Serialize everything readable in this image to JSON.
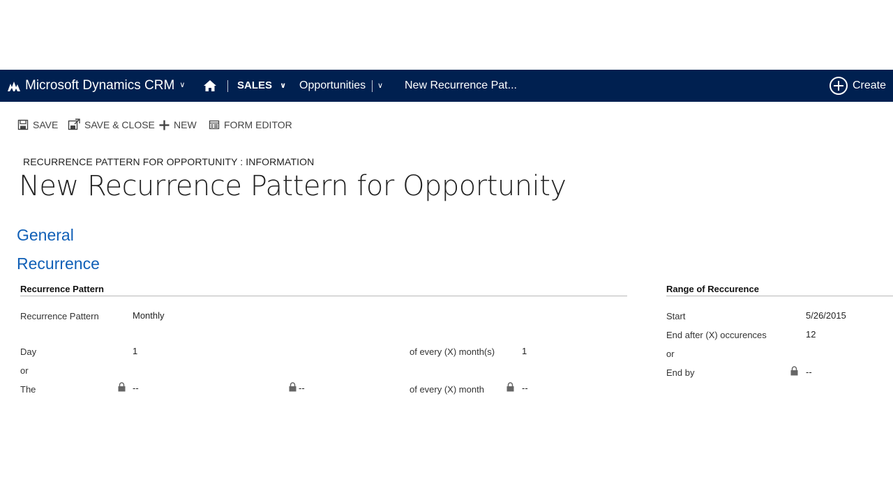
{
  "navbar": {
    "brand": "Microsoft Dynamics CRM",
    "area": "SALES",
    "entity": "Opportunities",
    "record": "New Recurrence Pat...",
    "create": "Create"
  },
  "commands": {
    "save": "SAVE",
    "save_close": "SAVE & CLOSE",
    "new": "NEW",
    "form_editor": "FORM EDITOR"
  },
  "header": {
    "entity_label": "RECURRENCE PATTERN FOR OPPORTUNITY : INFORMATION",
    "title": "New Recurrence Pattern for Opportunity"
  },
  "tabs": {
    "general": "General",
    "recurrence": "Recurrence"
  },
  "recurrence_pattern": {
    "section_title": "Recurrence Pattern",
    "pattern_label": "Recurrence Pattern",
    "pattern_value": "Monthly",
    "day_label": "Day",
    "day_value": "1",
    "or_label": "or",
    "the_label": "The",
    "the_value1": "--",
    "the_value2": "--",
    "every_months_label": "of every (X) month(s)",
    "every_months_value": "1",
    "every_month_label": "of every (X) month",
    "every_month_value": "--"
  },
  "range": {
    "section_title": "Range of Reccurence",
    "start_label": "Start",
    "start_value": "5/26/2015",
    "end_after_label": "End after (X) occurences",
    "end_after_value": "12",
    "or_label": "or",
    "end_by_label": "End by",
    "end_by_value": "--"
  },
  "colors": {
    "navbar_bg": "#002050",
    "tab_blue": "#1160b7"
  }
}
